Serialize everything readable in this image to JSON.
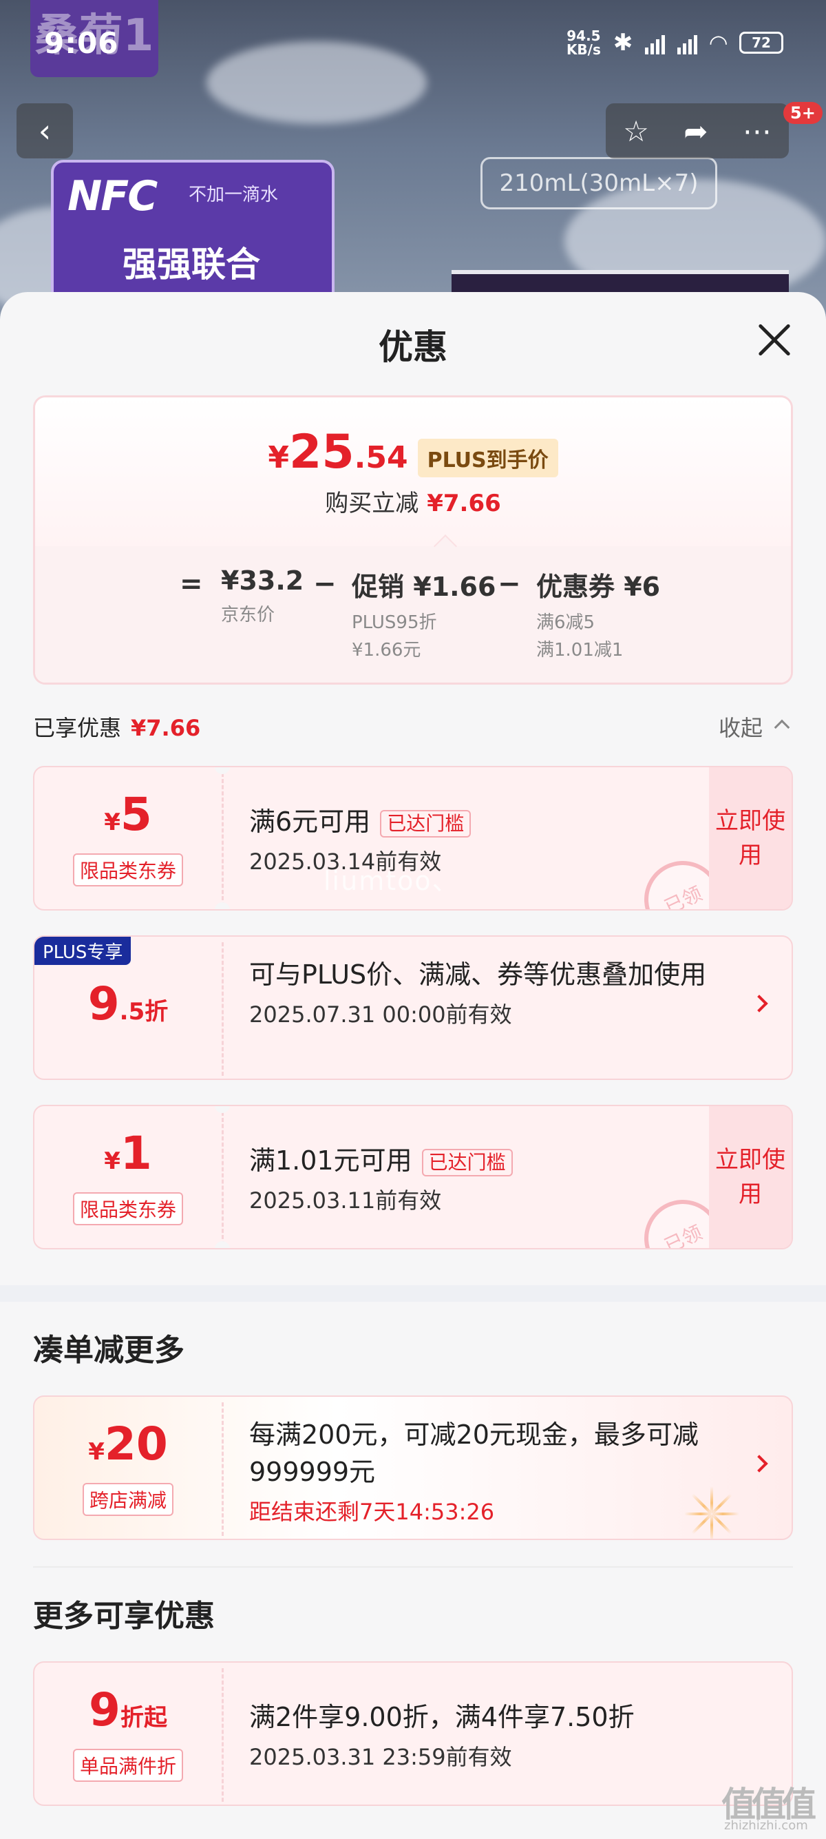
{
  "status_bar": {
    "time": "9:06",
    "net_speed": "94.5",
    "net_unit": "KB/s",
    "battery": "72"
  },
  "background": {
    "brand_text": "桑菊1",
    "nfc_logo": "NFC",
    "water_note": "不加一滴水",
    "slogan": "强强联合",
    "volume": "210mL(30mL×7)",
    "badge": "5+"
  },
  "sheet": {
    "title": "优惠"
  },
  "summary": {
    "yen": "¥",
    "price_int": "25",
    "price_dec": ".54",
    "plus_tag": "PLUS到手价",
    "buy_label": "购买立减",
    "buy_amount": "¥7.66",
    "eq": "=",
    "jd_price": "¥33.2",
    "jd_label": "京东价",
    "minus1": "−",
    "promo": "促销 ¥1.66",
    "promo_sub1": "PLUS95折",
    "promo_sub2": "¥1.66元",
    "minus2": "−",
    "coupon": "优惠券 ¥6",
    "coupon_sub1": "满6减5",
    "coupon_sub2": "满1.01减1"
  },
  "enjoyed": {
    "label": "已享优惠",
    "amount": "¥7.66",
    "collapse": "收起"
  },
  "coupons": [
    {
      "yen": "¥",
      "amount": "5",
      "tag": "限品类东券",
      "title": "满6元可用",
      "met": "已达门槛",
      "expiry": "2025.03.14前有效",
      "action": "立即使用",
      "stamp": "已领"
    },
    {
      "plus_badge": "PLUS专享",
      "amount": "9",
      "amount_small": ".5折",
      "title": "可与PLUS价、满减、券等优惠叠加使用",
      "expiry": "2025.07.31 00:00前有效"
    },
    {
      "yen": "¥",
      "amount": "1",
      "tag": "限品类东券",
      "title": "满1.01元可用",
      "met": "已达门槛",
      "expiry": "2025.03.11前有效",
      "action": "立即使用",
      "stamp": "已领"
    }
  ],
  "more_section": {
    "title": "凑单减更多"
  },
  "cross_store": {
    "yen": "¥",
    "amount": "20",
    "tag": "跨店满减",
    "title": "每满200元，可减20元现金，最多可减999999元",
    "countdown": "距结束还剩7天14:53:26"
  },
  "extra_section": {
    "title": "更多可享优惠"
  },
  "multi_item": {
    "amount": "9",
    "amount_small": "折起",
    "tag": "单品满件折",
    "title": "满2件享9.00折，满4件享7.50折",
    "expiry": "2025.03.31 23:59前有效"
  },
  "watermarks": {
    "overlay": "liumtoo、",
    "site": "值值值",
    "site_url": "zhizhizhi.com"
  }
}
